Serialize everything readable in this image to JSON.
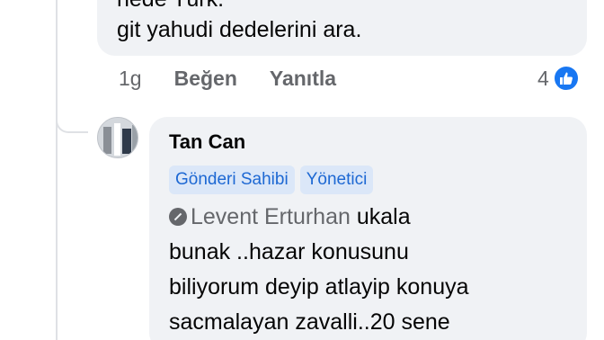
{
  "top_comment": {
    "line_cut": "nede Türk.",
    "line_main": "git yahudi dedelerini ara."
  },
  "actions": {
    "time": "1g",
    "like_label": "Beğen",
    "reply_label": "Yanıtla",
    "reaction_count": "4"
  },
  "reply": {
    "author": "Tan Can",
    "badges": [
      "Gönderi Sahibi",
      "Yönetici"
    ],
    "mention": "Levent Erturhan",
    "text_after_mention": " ukala",
    "lines": [
      "bunak ..hazar konusunu",
      "biliyorum deyip atlayip konuya",
      "sacmalayan zavalli..20 sene"
    ]
  },
  "colors": {
    "bubble": "#f0f2f5",
    "secondary_text": "#65676b",
    "like_blue": "#1877f2",
    "badge_bg": "#dbe7f8",
    "badge_text": "#1d68d3"
  },
  "icons": {
    "reaction": "like-icon",
    "mention": "mention-icon",
    "avatar": "avatar"
  }
}
